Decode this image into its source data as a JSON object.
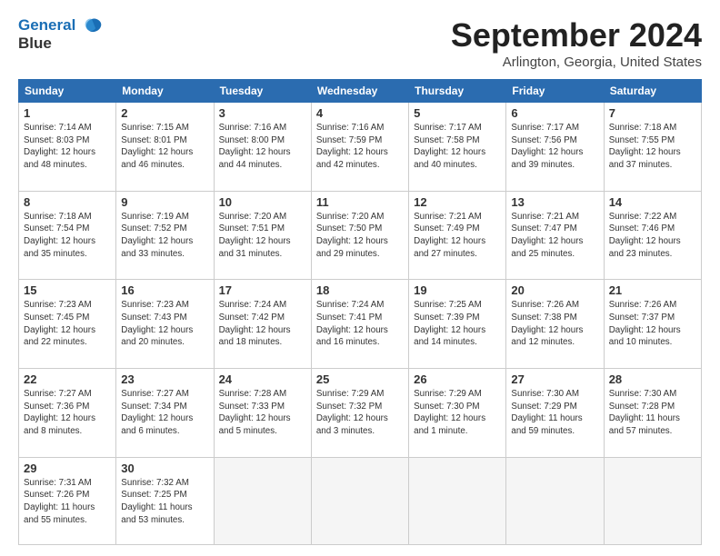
{
  "logo": {
    "line1": "General",
    "line2": "Blue"
  },
  "title": "September 2024",
  "location": "Arlington, Georgia, United States",
  "days_header": [
    "Sunday",
    "Monday",
    "Tuesday",
    "Wednesday",
    "Thursday",
    "Friday",
    "Saturday"
  ],
  "weeks": [
    [
      {
        "day": "1",
        "info": "Sunrise: 7:14 AM\nSunset: 8:03 PM\nDaylight: 12 hours\nand 48 minutes."
      },
      {
        "day": "2",
        "info": "Sunrise: 7:15 AM\nSunset: 8:01 PM\nDaylight: 12 hours\nand 46 minutes."
      },
      {
        "day": "3",
        "info": "Sunrise: 7:16 AM\nSunset: 8:00 PM\nDaylight: 12 hours\nand 44 minutes."
      },
      {
        "day": "4",
        "info": "Sunrise: 7:16 AM\nSunset: 7:59 PM\nDaylight: 12 hours\nand 42 minutes."
      },
      {
        "day": "5",
        "info": "Sunrise: 7:17 AM\nSunset: 7:58 PM\nDaylight: 12 hours\nand 40 minutes."
      },
      {
        "day": "6",
        "info": "Sunrise: 7:17 AM\nSunset: 7:56 PM\nDaylight: 12 hours\nand 39 minutes."
      },
      {
        "day": "7",
        "info": "Sunrise: 7:18 AM\nSunset: 7:55 PM\nDaylight: 12 hours\nand 37 minutes."
      }
    ],
    [
      {
        "day": "8",
        "info": "Sunrise: 7:18 AM\nSunset: 7:54 PM\nDaylight: 12 hours\nand 35 minutes."
      },
      {
        "day": "9",
        "info": "Sunrise: 7:19 AM\nSunset: 7:52 PM\nDaylight: 12 hours\nand 33 minutes."
      },
      {
        "day": "10",
        "info": "Sunrise: 7:20 AM\nSunset: 7:51 PM\nDaylight: 12 hours\nand 31 minutes."
      },
      {
        "day": "11",
        "info": "Sunrise: 7:20 AM\nSunset: 7:50 PM\nDaylight: 12 hours\nand 29 minutes."
      },
      {
        "day": "12",
        "info": "Sunrise: 7:21 AM\nSunset: 7:49 PM\nDaylight: 12 hours\nand 27 minutes."
      },
      {
        "day": "13",
        "info": "Sunrise: 7:21 AM\nSunset: 7:47 PM\nDaylight: 12 hours\nand 25 minutes."
      },
      {
        "day": "14",
        "info": "Sunrise: 7:22 AM\nSunset: 7:46 PM\nDaylight: 12 hours\nand 23 minutes."
      }
    ],
    [
      {
        "day": "15",
        "info": "Sunrise: 7:23 AM\nSunset: 7:45 PM\nDaylight: 12 hours\nand 22 minutes."
      },
      {
        "day": "16",
        "info": "Sunrise: 7:23 AM\nSunset: 7:43 PM\nDaylight: 12 hours\nand 20 minutes."
      },
      {
        "day": "17",
        "info": "Sunrise: 7:24 AM\nSunset: 7:42 PM\nDaylight: 12 hours\nand 18 minutes."
      },
      {
        "day": "18",
        "info": "Sunrise: 7:24 AM\nSunset: 7:41 PM\nDaylight: 12 hours\nand 16 minutes."
      },
      {
        "day": "19",
        "info": "Sunrise: 7:25 AM\nSunset: 7:39 PM\nDaylight: 12 hours\nand 14 minutes."
      },
      {
        "day": "20",
        "info": "Sunrise: 7:26 AM\nSunset: 7:38 PM\nDaylight: 12 hours\nand 12 minutes."
      },
      {
        "day": "21",
        "info": "Sunrise: 7:26 AM\nSunset: 7:37 PM\nDaylight: 12 hours\nand 10 minutes."
      }
    ],
    [
      {
        "day": "22",
        "info": "Sunrise: 7:27 AM\nSunset: 7:36 PM\nDaylight: 12 hours\nand 8 minutes."
      },
      {
        "day": "23",
        "info": "Sunrise: 7:27 AM\nSunset: 7:34 PM\nDaylight: 12 hours\nand 6 minutes."
      },
      {
        "day": "24",
        "info": "Sunrise: 7:28 AM\nSunset: 7:33 PM\nDaylight: 12 hours\nand 5 minutes."
      },
      {
        "day": "25",
        "info": "Sunrise: 7:29 AM\nSunset: 7:32 PM\nDaylight: 12 hours\nand 3 minutes."
      },
      {
        "day": "26",
        "info": "Sunrise: 7:29 AM\nSunset: 7:30 PM\nDaylight: 12 hours\nand 1 minute."
      },
      {
        "day": "27",
        "info": "Sunrise: 7:30 AM\nSunset: 7:29 PM\nDaylight: 11 hours\nand 59 minutes."
      },
      {
        "day": "28",
        "info": "Sunrise: 7:30 AM\nSunset: 7:28 PM\nDaylight: 11 hours\nand 57 minutes."
      }
    ],
    [
      {
        "day": "29",
        "info": "Sunrise: 7:31 AM\nSunset: 7:26 PM\nDaylight: 11 hours\nand 55 minutes."
      },
      {
        "day": "30",
        "info": "Sunrise: 7:32 AM\nSunset: 7:25 PM\nDaylight: 11 hours\nand 53 minutes."
      },
      {
        "day": "",
        "info": ""
      },
      {
        "day": "",
        "info": ""
      },
      {
        "day": "",
        "info": ""
      },
      {
        "day": "",
        "info": ""
      },
      {
        "day": "",
        "info": ""
      }
    ]
  ]
}
